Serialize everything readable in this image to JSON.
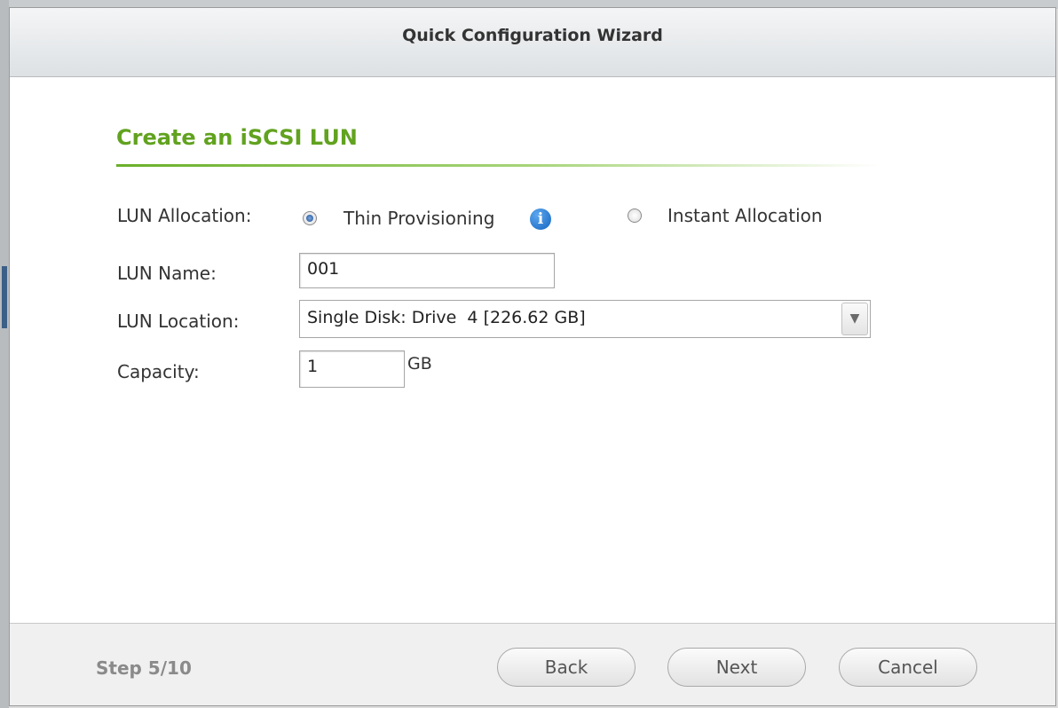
{
  "window": {
    "title": "Quick Configuration Wizard"
  },
  "section": {
    "title": "Create an iSCSI LUN"
  },
  "form": {
    "allocation": {
      "label": "LUN Allocation:",
      "options": [
        {
          "label": "Thin Provisioning",
          "selected": true
        },
        {
          "label": "Instant Allocation",
          "selected": false
        }
      ],
      "info_icon": "info-icon"
    },
    "name": {
      "label": "LUN Name:",
      "value": "001"
    },
    "location": {
      "label": "LUN Location:",
      "value": "Single Disk: Drive  4 [226.62 GB]"
    },
    "capacity": {
      "label": "Capacity:",
      "value": "1",
      "unit": "GB"
    }
  },
  "footer": {
    "step": "Step 5/10",
    "buttons": {
      "back": "Back",
      "next": "Next",
      "cancel": "Cancel"
    }
  },
  "colors": {
    "accent": "#61a21f",
    "info": "#1565c0"
  }
}
